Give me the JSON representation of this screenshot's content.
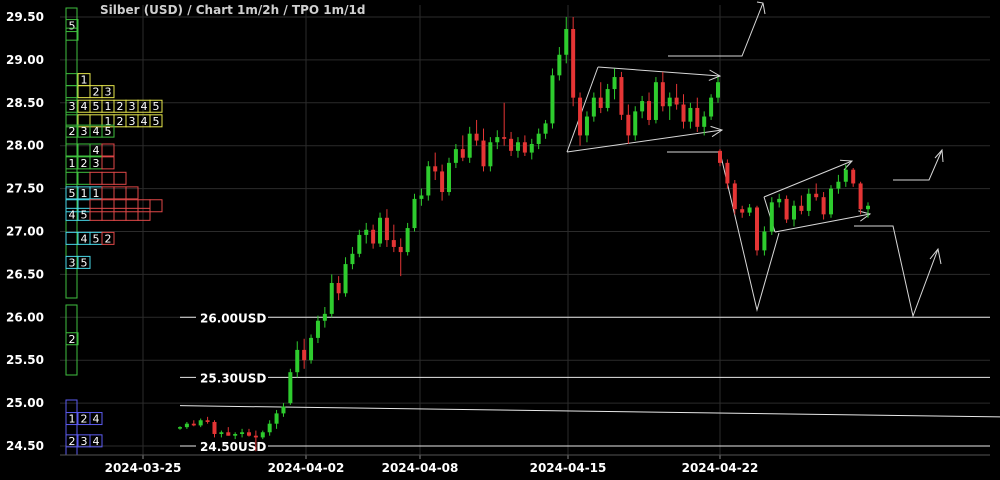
{
  "chart_data": {
    "type": "candlestick",
    "title": "Silber (USD) /  Chart 1m/2h / TPO 1m/1d",
    "ylim": [
      24.4,
      29.55
    ],
    "y_ticks": [
      "29.50",
      "29.00",
      "28.50",
      "28.00",
      "27.50",
      "27.00",
      "26.50",
      "26.00",
      "25.50",
      "25.00",
      "24.50"
    ],
    "x_ticks": [
      "2024-03-25",
      "2024-04-02",
      "2024-04-08",
      "2024-04-15",
      "2024-04-22"
    ],
    "grid": true,
    "colors": {
      "up": "#2ecc2e",
      "down": "#e53535",
      "background": "#000000",
      "grid": "#2b2b2b",
      "drawing": "#d8d8d8"
    },
    "levels": [
      {
        "label": "26.00USD",
        "price": 26.0
      },
      {
        "label": "25.30USD",
        "price": 25.3
      },
      {
        "label": "24.50USD",
        "price": 24.5
      }
    ],
    "series": [
      {
        "type": "candles",
        "ohlc": [
          [
            24.71,
            24.73,
            24.69,
            24.72
          ],
          [
            24.72,
            24.78,
            24.7,
            24.76
          ],
          [
            24.76,
            24.8,
            24.73,
            24.74
          ],
          [
            24.74,
            24.82,
            24.72,
            24.8
          ],
          [
            24.8,
            24.84,
            24.76,
            24.78
          ],
          [
            24.78,
            24.8,
            24.6,
            24.64
          ],
          [
            24.64,
            24.68,
            24.6,
            24.66
          ],
          [
            24.66,
            24.72,
            24.62,
            24.62
          ],
          [
            24.62,
            24.66,
            24.58,
            24.64
          ],
          [
            24.64,
            24.7,
            24.6,
            24.66
          ],
          [
            24.66,
            24.7,
            24.61,
            24.62
          ],
          [
            24.62,
            24.68,
            24.44,
            24.6
          ],
          [
            24.6,
            24.68,
            24.58,
            24.66
          ],
          [
            24.66,
            24.8,
            24.62,
            24.76
          ],
          [
            24.76,
            24.92,
            24.7,
            24.88
          ],
          [
            24.88,
            25.0,
            24.84,
            24.96
          ],
          [
            25.0,
            25.4,
            24.98,
            25.36
          ],
          [
            25.36,
            25.72,
            25.3,
            25.62
          ],
          [
            25.62,
            25.75,
            25.4,
            25.5
          ],
          [
            25.5,
            25.8,
            25.46,
            25.76
          ],
          [
            25.76,
            26.02,
            25.7,
            25.96
          ],
          [
            25.96,
            26.12,
            25.88,
            26.04
          ],
          [
            26.04,
            26.5,
            26.0,
            26.4
          ],
          [
            26.4,
            26.48,
            26.2,
            26.28
          ],
          [
            26.28,
            26.7,
            26.24,
            26.62
          ],
          [
            26.62,
            26.82,
            26.56,
            26.74
          ],
          [
            26.74,
            27.02,
            26.7,
            26.96
          ],
          [
            26.96,
            27.1,
            26.86,
            27.02
          ],
          [
            27.02,
            27.08,
            26.8,
            26.86
          ],
          [
            26.86,
            27.22,
            26.82,
            27.16
          ],
          [
            27.16,
            27.26,
            26.82,
            26.9
          ],
          [
            26.9,
            27.08,
            26.76,
            26.82
          ],
          [
            26.82,
            26.92,
            26.48,
            26.76
          ],
          [
            26.76,
            27.1,
            26.72,
            27.04
          ],
          [
            27.04,
            27.44,
            27.0,
            27.38
          ],
          [
            27.38,
            27.5,
            27.3,
            27.42
          ],
          [
            27.42,
            27.82,
            27.36,
            27.76
          ],
          [
            27.76,
            27.92,
            27.6,
            27.7
          ],
          [
            27.7,
            27.78,
            27.36,
            27.46
          ],
          [
            27.46,
            27.86,
            27.42,
            27.8
          ],
          [
            27.8,
            28.02,
            27.74,
            27.96
          ],
          [
            27.96,
            28.12,
            27.82,
            27.86
          ],
          [
            27.86,
            28.22,
            27.8,
            28.14
          ],
          [
            28.14,
            28.3,
            28.0,
            28.06
          ],
          [
            28.06,
            28.2,
            27.7,
            27.76
          ],
          [
            27.76,
            28.1,
            27.7,
            28.04
          ],
          [
            28.04,
            28.18,
            27.96,
            28.1
          ],
          [
            28.1,
            28.5,
            28.0,
            28.08
          ],
          [
            28.08,
            28.16,
            27.88,
            27.94
          ],
          [
            27.94,
            28.1,
            27.86,
            28.04
          ],
          [
            28.04,
            28.12,
            27.88,
            27.92
          ],
          [
            27.92,
            28.08,
            27.84,
            28.02
          ],
          [
            28.02,
            28.2,
            27.96,
            28.14
          ],
          [
            28.14,
            28.3,
            28.08,
            28.26
          ],
          [
            28.26,
            28.9,
            28.2,
            28.82
          ],
          [
            28.82,
            29.15,
            28.76,
            29.06
          ],
          [
            29.06,
            29.5,
            28.96,
            29.36
          ],
          [
            29.36,
            29.5,
            28.46,
            28.56
          ],
          [
            28.56,
            28.62,
            28.0,
            28.12
          ],
          [
            28.12,
            28.4,
            28.04,
            28.34
          ],
          [
            28.34,
            28.62,
            28.28,
            28.56
          ],
          [
            28.56,
            28.74,
            28.38,
            28.44
          ],
          [
            28.44,
            28.72,
            28.4,
            28.66
          ],
          [
            28.66,
            28.9,
            28.54,
            28.8
          ],
          [
            28.8,
            28.86,
            28.3,
            28.36
          ],
          [
            28.36,
            28.48,
            28.02,
            28.12
          ],
          [
            28.12,
            28.46,
            28.06,
            28.4
          ],
          [
            28.4,
            28.58,
            28.32,
            28.52
          ],
          [
            28.52,
            28.62,
            28.24,
            28.3
          ],
          [
            28.3,
            28.8,
            28.26,
            28.74
          ],
          [
            28.74,
            28.86,
            28.4,
            28.46
          ],
          [
            28.46,
            28.62,
            28.3,
            28.56
          ],
          [
            28.56,
            28.72,
            28.42,
            28.48
          ],
          [
            28.48,
            28.6,
            28.2,
            28.28
          ],
          [
            28.28,
            28.5,
            28.2,
            28.44
          ],
          [
            28.44,
            28.56,
            28.16,
            28.22
          ],
          [
            28.22,
            28.4,
            28.12,
            28.34
          ],
          [
            28.34,
            28.6,
            28.3,
            28.56
          ],
          [
            28.56,
            28.8,
            28.5,
            28.74
          ],
          [
            27.94,
            27.96,
            27.76,
            27.8
          ],
          [
            27.8,
            27.84,
            27.5,
            27.56
          ],
          [
            27.56,
            27.6,
            27.2,
            27.26
          ],
          [
            27.26,
            27.3,
            27.16,
            27.22
          ],
          [
            27.22,
            27.32,
            27.18,
            27.28
          ],
          [
            27.28,
            27.3,
            26.72,
            26.78
          ],
          [
            26.78,
            27.06,
            26.72,
            27.0
          ],
          [
            27.0,
            27.4,
            26.96,
            27.34
          ],
          [
            27.34,
            27.44,
            27.28,
            27.38
          ],
          [
            27.38,
            27.42,
            27.1,
            27.14
          ],
          [
            27.14,
            27.36,
            27.06,
            27.3
          ],
          [
            27.3,
            27.42,
            27.2,
            27.24
          ],
          [
            27.24,
            27.5,
            27.18,
            27.44
          ],
          [
            27.44,
            27.56,
            27.36,
            27.4
          ],
          [
            27.4,
            27.46,
            27.14,
            27.2
          ],
          [
            27.2,
            27.54,
            27.16,
            27.5
          ],
          [
            27.5,
            27.66,
            27.44,
            27.58
          ],
          [
            27.58,
            27.78,
            27.52,
            27.72
          ],
          [
            27.72,
            27.74,
            27.52,
            27.56
          ],
          [
            27.56,
            27.58,
            27.2,
            27.26
          ],
          [
            27.26,
            27.34,
            27.16,
            27.3
          ]
        ]
      }
    ],
    "tpo_profile": {
      "rows": [
        {
          "price": 29.4,
          "cells": [
            {
              "t": "5",
              "c": "#3fbf3f"
            }
          ]
        },
        {
          "price": 29.3,
          "cells": [
            {
              "t": "",
              "c": "#3fbf3f"
            }
          ]
        },
        {
          "price": 28.77,
          "cells": [
            {
              "t": "",
              "c": "#3fbf3f"
            },
            {
              "t": "1",
              "c": "#e6e64c"
            }
          ]
        },
        {
          "price": 28.63,
          "cells": [
            {
              "t": "",
              "c": "#3fbf3f"
            },
            {
              "t": "",
              "c": "#e6e64c"
            },
            {
              "t": "2",
              "c": "#e6e64c"
            },
            {
              "t": "3",
              "c": "#e6e64c"
            }
          ]
        },
        {
          "price": 28.46,
          "cells": [
            {
              "t": "3",
              "c": "#3fbf3f"
            },
            {
              "t": "4",
              "c": "#e6e64c"
            },
            {
              "t": "5",
              "c": "#e6e64c"
            },
            {
              "t": "1",
              "c": "#e6e64c"
            },
            {
              "t": "2",
              "c": "#e6e64c"
            },
            {
              "t": "3",
              "c": "#e6e64c"
            },
            {
              "t": "4",
              "c": "#e6e64c"
            },
            {
              "t": "5",
              "c": "#e6e64c"
            }
          ]
        },
        {
          "price": 28.29,
          "cells": [
            {
              "t": "",
              "c": "#3fbf3f"
            },
            {
              "t": "",
              "c": "#e6e64c"
            },
            {
              "t": "",
              "c": "#e6e64c"
            },
            {
              "t": "1",
              "c": "#e6e64c"
            },
            {
              "t": "2",
              "c": "#e6e64c"
            },
            {
              "t": "3",
              "c": "#e6e64c"
            },
            {
              "t": "4",
              "c": "#e6e64c"
            },
            {
              "t": "5",
              "c": "#e6e64c"
            }
          ]
        },
        {
          "price": 28.17,
          "cells": [
            {
              "t": "2",
              "c": "#3fbf3f"
            },
            {
              "t": "3",
              "c": "#3fbf3f"
            },
            {
              "t": "4",
              "c": "#3fbf3f"
            },
            {
              "t": "5",
              "c": "#3fbf3f"
            }
          ]
        },
        {
          "price": 27.95,
          "cells": [
            {
              "t": "",
              "c": "#3fbf3f"
            },
            {
              "t": "",
              "c": "#3fbf3f"
            },
            {
              "t": "4",
              "c": "#3fbf3f"
            },
            {
              "t": "",
              "c": "#e04848"
            }
          ]
        },
        {
          "price": 27.8,
          "cells": [
            {
              "t": "1",
              "c": "#3fbf3f"
            },
            {
              "t": "2",
              "c": "#3fbf3f"
            },
            {
              "t": "3",
              "c": "#3fbf3f"
            },
            {
              "t": "",
              "c": "#e04848"
            }
          ]
        },
        {
          "price": 27.62,
          "cells": [
            {
              "t": "",
              "c": "#3fbf3f"
            },
            {
              "t": "",
              "c": "#3fbf3f"
            },
            {
              "t": "",
              "c": "#e04848"
            },
            {
              "t": "",
              "c": "#e04848"
            },
            {
              "t": "",
              "c": "#e04848"
            }
          ]
        },
        {
          "price": 27.45,
          "cells": [
            {
              "t": "5",
              "c": "#48d8e8"
            },
            {
              "t": "1",
              "c": "#48d8e8"
            },
            {
              "t": "1",
              "c": "#48d8e8"
            },
            {
              "t": "",
              "c": "#e04848"
            },
            {
              "t": "",
              "c": "#e04848"
            },
            {
              "t": "",
              "c": "#e04848"
            }
          ]
        },
        {
          "price": 27.3,
          "cells": [
            {
              "t": "",
              "c": "#48d8e8"
            },
            {
              "t": "",
              "c": "#48d8e8"
            },
            {
              "t": "",
              "c": "#e04848"
            },
            {
              "t": "",
              "c": "#e04848"
            },
            {
              "t": "",
              "c": "#e04848"
            },
            {
              "t": "",
              "c": "#e04848"
            },
            {
              "t": "",
              "c": "#e04848"
            },
            {
              "t": "",
              "c": "#e04848"
            }
          ]
        },
        {
          "price": 27.2,
          "cells": [
            {
              "t": "4",
              "c": "#48d8e8"
            },
            {
              "t": "5",
              "c": "#48d8e8"
            },
            {
              "t": "",
              "c": "#e04848"
            },
            {
              "t": "",
              "c": "#e04848"
            },
            {
              "t": "",
              "c": "#e04848"
            },
            {
              "t": "",
              "c": "#e04848"
            },
            {
              "t": "",
              "c": "#e04848"
            }
          ]
        },
        {
          "price": 26.92,
          "cells": [
            {
              "t": "",
              "c": "#48d8e8"
            },
            {
              "t": "4",
              "c": "#48d8e8"
            },
            {
              "t": "5",
              "c": "#48d8e8"
            },
            {
              "t": "2",
              "c": "#e04848"
            }
          ]
        },
        {
          "price": 26.64,
          "cells": [
            {
              "t": "3",
              "c": "#48d8e8"
            },
            {
              "t": "5",
              "c": "#48d8e8"
            }
          ]
        },
        {
          "price": 25.75,
          "cells": [
            {
              "t": "2",
              "c": "#3fbf3f"
            }
          ]
        },
        {
          "price": 24.82,
          "cells": [
            {
              "t": "1",
              "c": "#5c5cf0"
            },
            {
              "t": "2",
              "c": "#5c5cf0"
            },
            {
              "t": "4",
              "c": "#5c5cf0"
            }
          ]
        },
        {
          "price": 24.56,
          "cells": [
            {
              "t": "2",
              "c": "#5c5cf0"
            },
            {
              "t": "3",
              "c": "#5c5cf0"
            },
            {
              "t": "4",
              "c": "#5c5cf0"
            }
          ]
        }
      ]
    }
  }
}
